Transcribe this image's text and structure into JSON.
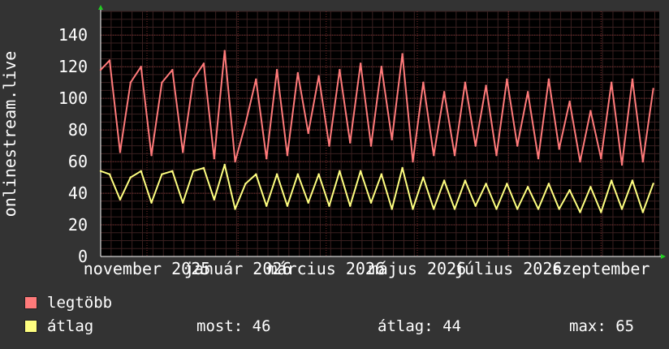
{
  "chart_data": {
    "type": "line",
    "ylabel": "onlinestream.live",
    "ylim": [
      0,
      155
    ],
    "yticks": [
      0,
      20,
      40,
      60,
      80,
      100,
      120,
      140
    ],
    "x_tick_labels": [
      "november 2025",
      "január 2026",
      "március 2026",
      "május 2026",
      "július 2026",
      "szeptember"
    ],
    "x_tick_dates": [
      "2025-11-01",
      "2026-01-01",
      "2026-03-01",
      "2026-05-01",
      "2026-07-01",
      "2026-09-01"
    ],
    "x_range": [
      "2025-10-01",
      "2026-10-10"
    ],
    "grid": true,
    "series": [
      {
        "name": "legtöbb",
        "color": "#ff7a7a",
        "points": [
          [
            "2025-10-01",
            118
          ],
          [
            "2025-10-07",
            124
          ],
          [
            "2025-10-14",
            66
          ],
          [
            "2025-10-21",
            110
          ],
          [
            "2025-10-28",
            120
          ],
          [
            "2025-11-04",
            64
          ],
          [
            "2025-11-11",
            110
          ],
          [
            "2025-11-18",
            118
          ],
          [
            "2025-11-25",
            66
          ],
          [
            "2025-12-02",
            112
          ],
          [
            "2025-12-09",
            122
          ],
          [
            "2025-12-16",
            62
          ],
          [
            "2025-12-23",
            130
          ],
          [
            "2025-12-30",
            60
          ],
          [
            "2026-01-06",
            84
          ],
          [
            "2026-01-13",
            112
          ],
          [
            "2026-01-20",
            62
          ],
          [
            "2026-01-27",
            118
          ],
          [
            "2026-02-03",
            64
          ],
          [
            "2026-02-10",
            116
          ],
          [
            "2026-02-17",
            78
          ],
          [
            "2026-02-24",
            114
          ],
          [
            "2026-03-03",
            70
          ],
          [
            "2026-03-10",
            118
          ],
          [
            "2026-03-17",
            72
          ],
          [
            "2026-03-24",
            122
          ],
          [
            "2026-03-31",
            70
          ],
          [
            "2026-04-07",
            120
          ],
          [
            "2026-04-14",
            74
          ],
          [
            "2026-04-21",
            128
          ],
          [
            "2026-04-28",
            60
          ],
          [
            "2026-05-05",
            110
          ],
          [
            "2026-05-12",
            64
          ],
          [
            "2026-05-19",
            104
          ],
          [
            "2026-05-26",
            64
          ],
          [
            "2026-06-02",
            110
          ],
          [
            "2026-06-09",
            70
          ],
          [
            "2026-06-16",
            108
          ],
          [
            "2026-06-23",
            64
          ],
          [
            "2026-06-30",
            112
          ],
          [
            "2026-07-07",
            70
          ],
          [
            "2026-07-14",
            104
          ],
          [
            "2026-07-21",
            62
          ],
          [
            "2026-07-28",
            112
          ],
          [
            "2026-08-04",
            68
          ],
          [
            "2026-08-11",
            98
          ],
          [
            "2026-08-18",
            60
          ],
          [
            "2026-08-25",
            92
          ],
          [
            "2026-09-01",
            62
          ],
          [
            "2026-09-08",
            110
          ],
          [
            "2026-09-15",
            58
          ],
          [
            "2026-09-22",
            112
          ],
          [
            "2026-09-29",
            60
          ],
          [
            "2026-10-06",
            106
          ]
        ]
      },
      {
        "name": "átlag",
        "color": "#ffff80",
        "points": [
          [
            "2025-10-01",
            54
          ],
          [
            "2025-10-07",
            52
          ],
          [
            "2025-10-14",
            36
          ],
          [
            "2025-10-21",
            50
          ],
          [
            "2025-10-28",
            54
          ],
          [
            "2025-11-04",
            34
          ],
          [
            "2025-11-11",
            52
          ],
          [
            "2025-11-18",
            54
          ],
          [
            "2025-11-25",
            34
          ],
          [
            "2025-12-02",
            54
          ],
          [
            "2025-12-09",
            56
          ],
          [
            "2025-12-16",
            36
          ],
          [
            "2025-12-23",
            58
          ],
          [
            "2025-12-30",
            30
          ],
          [
            "2026-01-06",
            46
          ],
          [
            "2026-01-13",
            52
          ],
          [
            "2026-01-20",
            32
          ],
          [
            "2026-01-27",
            52
          ],
          [
            "2026-02-03",
            32
          ],
          [
            "2026-02-10",
            52
          ],
          [
            "2026-02-17",
            34
          ],
          [
            "2026-02-24",
            52
          ],
          [
            "2026-03-03",
            32
          ],
          [
            "2026-03-10",
            54
          ],
          [
            "2026-03-17",
            32
          ],
          [
            "2026-03-24",
            54
          ],
          [
            "2026-03-31",
            34
          ],
          [
            "2026-04-07",
            52
          ],
          [
            "2026-04-14",
            30
          ],
          [
            "2026-04-21",
            56
          ],
          [
            "2026-04-28",
            30
          ],
          [
            "2026-05-05",
            50
          ],
          [
            "2026-05-12",
            30
          ],
          [
            "2026-05-19",
            48
          ],
          [
            "2026-05-26",
            30
          ],
          [
            "2026-06-02",
            48
          ],
          [
            "2026-06-09",
            32
          ],
          [
            "2026-06-16",
            46
          ],
          [
            "2026-06-23",
            30
          ],
          [
            "2026-06-30",
            46
          ],
          [
            "2026-07-07",
            30
          ],
          [
            "2026-07-14",
            44
          ],
          [
            "2026-07-21",
            30
          ],
          [
            "2026-07-28",
            46
          ],
          [
            "2026-08-04",
            30
          ],
          [
            "2026-08-11",
            42
          ],
          [
            "2026-08-18",
            28
          ],
          [
            "2026-08-25",
            44
          ],
          [
            "2026-09-01",
            28
          ],
          [
            "2026-09-08",
            48
          ],
          [
            "2026-09-15",
            30
          ],
          [
            "2026-09-22",
            48
          ],
          [
            "2026-09-29",
            28
          ],
          [
            "2026-10-06",
            46
          ]
        ]
      }
    ]
  },
  "legend": {
    "items": [
      {
        "label": "legtöbb",
        "color": "#ff7a7a"
      },
      {
        "label": "átlag",
        "color": "#ffff80"
      }
    ]
  },
  "stats": {
    "now_label": "most:",
    "now_value": "46",
    "avg_label": "átlag:",
    "avg_value": "44",
    "max_label": "max:",
    "max_value": "65"
  }
}
